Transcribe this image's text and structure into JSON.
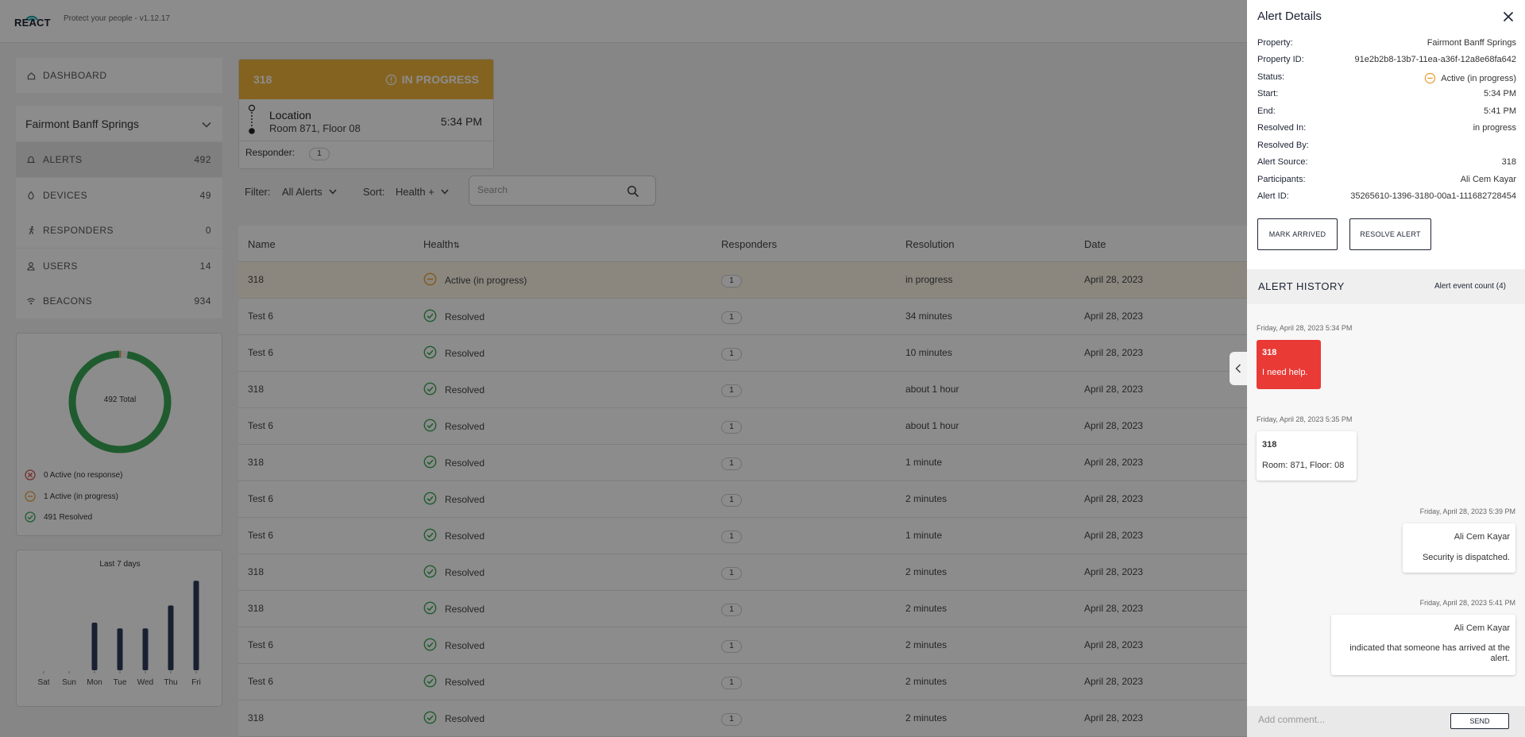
{
  "header": {
    "brand": "REACT",
    "tagline": "Protect your people - v1.12.17"
  },
  "sidebar": {
    "dashboard_label": "DASHBOARD",
    "property_name": "Fairmont Banff Springs",
    "items": [
      {
        "label": "ALERTS",
        "count": "492",
        "icon": "bell-icon"
      },
      {
        "label": "DEVICES",
        "count": "49",
        "icon": "device-icon"
      },
      {
        "label": "RESPONDERS",
        "count": "0",
        "icon": "runner-icon"
      },
      {
        "label": "USERS",
        "count": "14",
        "icon": "user-icon"
      },
      {
        "label": "BEACONS",
        "count": "934",
        "icon": "beacon-icon"
      }
    ]
  },
  "summary": {
    "total_label": "492 Total",
    "legend": [
      {
        "label": "0 Active (no response)",
        "color": "#d9534f"
      },
      {
        "label": "1 Active (in progress)",
        "color": "#e8a33c"
      },
      {
        "label": "491 Resolved",
        "color": "#3aa655"
      }
    ],
    "donut": {
      "resolved": 491,
      "in_progress": 1,
      "no_response": 0,
      "total": 492
    }
  },
  "chart_data": {
    "type": "bar",
    "title": "Last 7 days",
    "categories": [
      "Sat",
      "Sun",
      "Mon",
      "Tue",
      "Wed",
      "Thu",
      "Fri"
    ],
    "values": [
      0,
      0,
      50,
      44,
      44,
      68,
      94
    ],
    "ylim": [
      0,
      100
    ],
    "color": "#2f3b59"
  },
  "alert_card": {
    "id": "318",
    "status": "IN PROGRESS",
    "location_title": "Location",
    "location_detail": "Room 871, Floor 08",
    "time": "5:34 PM",
    "responder_label": "Responder:",
    "responder_count": "1"
  },
  "filters": {
    "filter_label": "Filter:",
    "filter_value": "All Alerts",
    "sort_label": "Sort:",
    "sort_value": "Health +",
    "search_placeholder": "Search"
  },
  "table": {
    "columns": [
      "Name",
      "Health",
      "Responders",
      "Resolution",
      "Date"
    ],
    "rows": [
      {
        "name": "318",
        "health": "Active (in progress)",
        "responders": "1",
        "resolution": "in progress",
        "date": "April 28, 2023"
      },
      {
        "name": "Test 6",
        "health": "Resolved",
        "responders": "1",
        "resolution": "34 minutes",
        "date": "April 28, 2023"
      },
      {
        "name": "Test 6",
        "health": "Resolved",
        "responders": "1",
        "resolution": "10 minutes",
        "date": "April 28, 2023"
      },
      {
        "name": "318",
        "health": "Resolved",
        "responders": "1",
        "resolution": "about 1 hour",
        "date": "April 28, 2023"
      },
      {
        "name": "Test 6",
        "health": "Resolved",
        "responders": "1",
        "resolution": "about 1 hour",
        "date": "April 28, 2023"
      },
      {
        "name": "318",
        "health": "Resolved",
        "responders": "1",
        "resolution": "1 minute",
        "date": "April 28, 2023"
      },
      {
        "name": "Test 6",
        "health": "Resolved",
        "responders": "1",
        "resolution": "2 minutes",
        "date": "April 28, 2023"
      },
      {
        "name": "Test 6",
        "health": "Resolved",
        "responders": "1",
        "resolution": "1 minute",
        "date": "April 28, 2023"
      },
      {
        "name": "318",
        "health": "Resolved",
        "responders": "1",
        "resolution": "2 minutes",
        "date": "April 28, 2023"
      },
      {
        "name": "318",
        "health": "Resolved",
        "responders": "1",
        "resolution": "2 minutes",
        "date": "April 28, 2023"
      },
      {
        "name": "Test 6",
        "health": "Resolved",
        "responders": "1",
        "resolution": "2 minutes",
        "date": "April 28, 2023"
      },
      {
        "name": "Test 6",
        "health": "Resolved",
        "responders": "1",
        "resolution": "2 minutes",
        "date": "April 28, 2023"
      },
      {
        "name": "318",
        "health": "Resolved",
        "responders": "1",
        "resolution": "2 minutes",
        "date": "April 28, 2023"
      }
    ]
  },
  "panel": {
    "title": "Alert Details",
    "fields": [
      {
        "key": "Property:",
        "value": "Fairmont Banff Springs"
      },
      {
        "key": "Property ID:",
        "value": "91e2b2b8-13b7-11ea-a36f-12a8e68fa642"
      },
      {
        "key": "Status:",
        "value": "Active (in progress)"
      },
      {
        "key": "Start:",
        "value": "5:34 PM"
      },
      {
        "key": "End:",
        "value": "5:41 PM"
      },
      {
        "key": "Resolved In:",
        "value": "in progress"
      },
      {
        "key": "Resolved By:",
        "value": ""
      },
      {
        "key": "Alert Source:",
        "value": "318"
      },
      {
        "key": "Participants:",
        "value": "Ali Cem Kayar"
      },
      {
        "key": "Alert ID:",
        "value": "35265610-1396-3180-00a1-111682728454"
      }
    ],
    "mark_arrived": "MARK ARRIVED",
    "resolve_alert": "RESOLVE ALERT",
    "history_title": "ALERT HISTORY",
    "history_count": "Alert event count (4)",
    "events": [
      {
        "timestamp": "Friday, April 28, 2023 5:34 PM",
        "title": "318",
        "body": "I need help."
      },
      {
        "timestamp": "Friday, April 28, 2023 5:35 PM",
        "title": "318",
        "body": "Room: 871, Floor: 08"
      },
      {
        "timestamp": "Friday, April 28, 2023 5:39 PM",
        "title": "Ali Cem Kayar",
        "body": "Security is dispatched."
      },
      {
        "timestamp": "Friday, April 28, 2023 5:41 PM",
        "title": "Ali Cem Kayar",
        "body": "indicated that someone has arrived at the alert."
      }
    ],
    "comment_placeholder": "Add comment...",
    "send_label": "SEND"
  },
  "colors": {
    "accent": "#f0b43c",
    "navy": "#1c2333",
    "resolved": "#3aa655",
    "alert_red": "#e93a36"
  }
}
